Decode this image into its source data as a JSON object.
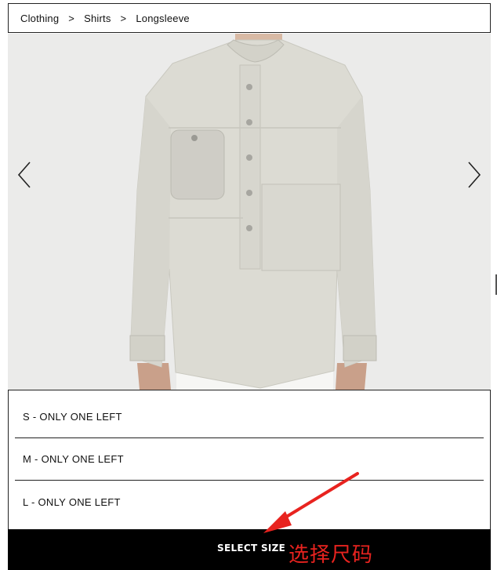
{
  "breadcrumb": {
    "items": [
      "Clothing",
      "Shirts",
      "Longsleeve"
    ],
    "separator": ">"
  },
  "gallery": {
    "product_image": "longsleeve-shirt-photo",
    "prev_icon": "chevron-left-icon",
    "next_icon": "chevron-right-icon"
  },
  "sizes": {
    "options": [
      {
        "label": "S - ONLY ONE LEFT"
      },
      {
        "label": "M - ONLY ONE LEFT"
      },
      {
        "label": "L - ONLY ONE LEFT"
      }
    ]
  },
  "select_bar": {
    "label": "SELECT SIZE"
  },
  "annotation": {
    "text": "选择尺码",
    "color": "#e8231f"
  },
  "colors": {
    "accent": "#000000",
    "background": "#ffffff",
    "image_background": "#e9e9e7",
    "shirt": "#dcdbd3"
  }
}
